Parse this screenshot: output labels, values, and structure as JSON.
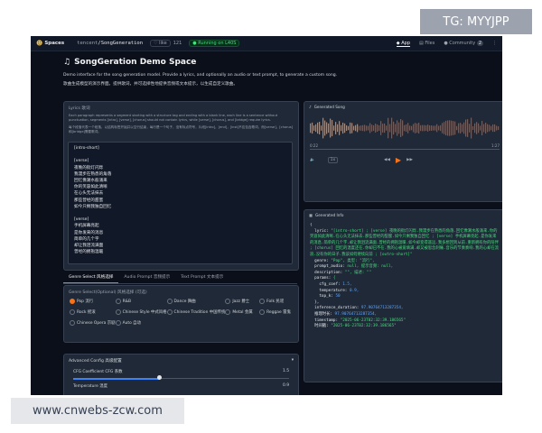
{
  "watermark_top": "TG: MYYJPP",
  "watermark_bottom": "www.cnwebs-zcw.com",
  "topbar": {
    "brand": "Spaces",
    "org": "tencent",
    "repo": "SongGeneration",
    "like_label": "like",
    "likes": "121",
    "status": "Running on L40S",
    "nav": {
      "app": "App",
      "files": "Files",
      "community": "Community",
      "community_count": "2"
    }
  },
  "header": {
    "title": "SongGeration Demo Space",
    "desc_en": "Demo interface for the song generation model. Provide a lyrics, and optionally an audio or text prompt, to generate a custom song.",
    "desc_zh": "歌曲生成模型的演示界面。提供歌词，并可选择性地提供音频或文本提示，以生成自定义歌曲。"
  },
  "lyrics": {
    "label": "Lyrics 歌词",
    "help_en": "Each paragraph represents a segment starting with a structure tag and ending with a blank line, each line is a sentence without punctuation, segments [intro], [verse], [chorus] should not contain lyrics, while [verse], [chorus], and [bridge] require lyrics.",
    "help_zh": "每个段落代表一个段落，以结构标签开始并以空行结束，每行是一个句子，没有标点符号，片段[intro]，[end]，[inst]不应包含歌词，而[verse]，[chorus]和[bridge]需要歌词。",
    "text": "[intro-short]\n\n[verse]\n夜晚的街灯闪烁\n我漫步在熟悉的角落\n回忆像潮水般涌来\n你的笑容如此清晰\n在心头无法抹去\n那些曾经的甜蜜\n如今只剩我独自回忆\n\n[verse]\n手机屏幕亮起\n是你发来的消息\n简单的几个字\n却让我泪流满面\n曾经的拥抱温暖"
  },
  "generated_song": {
    "label": "Generated Song",
    "time_current": "0:22",
    "time_total": "1:27",
    "speed": "1x"
  },
  "generated_info": {
    "label": "Generated Info",
    "lines": [
      {
        "k": "{",
        "v": ""
      },
      {
        "k": "  lyric: ",
        "v": "\"[intro-short] ; [verse] 夜晚的街灯闪烁.我漫步在熟悉的角落.回忆像潮水般涌来.你的笑容如此清晰.在心头无法抹去.那些曾经的甜蜜.如今只剩我独自回忆 ; [verse] 手机屏幕亮起.是你发来的消息.简单的几个字.却让我泪流满面.曾经的拥抱温暖.如今却变得遥远.我多想回到从前.重新拥有你的陪伴 ; [chorus] 回忆的温度还在.你却已不在.我的心被爱填满.却又被思念刺痛.音乐的节奏奏响.我的心却在流浪.没有你的日子.我该如何继续向前 ; [outro-short]\""
      },
      {
        "k": "  genre: ",
        "v": "\"Pop\", 类型: \"流行\","
      },
      {
        "k": "  prompt_audio: ",
        "v": "null, 提示音频: null,"
      },
      {
        "k": "  description: ",
        "v": "\"\", 描述: \"\""
      },
      {
        "k": "  params: ",
        "v": "{"
      },
      {
        "k": "    cfg_coef: ",
        "v": "1.5,"
      },
      {
        "k": "    temperature: ",
        "v": "0.9,"
      },
      {
        "k": "    top_k: ",
        "v": "50"
      },
      {
        "k": "  },",
        "v": ""
      },
      {
        "k": "  inference_duration: ",
        "v": "97.90764713287354,"
      },
      {
        "k": "  推理时长: ",
        "v": "97.90764713287354,"
      },
      {
        "k": "  timestamp: ",
        "v": "\"2025-06-23T02:32:39.186565\""
      },
      {
        "k": "  时间戳: ",
        "v": "\"2025-06-23T02:32:39.186565\""
      }
    ]
  },
  "tabs": [
    "Genre Select 风格选择",
    "Audio Prompt 音频提示",
    "Text Prompt 文本提示"
  ],
  "genre": {
    "label": "Genre Select(Optional) 风格选择 (可选)",
    "selected": "Pop 流行",
    "options": [
      "Pop 流行",
      "R&B",
      "Dance 舞曲",
      "Jazz 爵士",
      "Folk 民谣",
      "Rock 摇滚",
      "Chinese Style 中式风格",
      "Chinese Tradition 中国传统",
      "Metal 金属",
      "Reggae 雷鬼",
      "Chinese Opera 京剧",
      "Auto 自动"
    ]
  },
  "advanced": {
    "label": "Advanced Config 高级配置",
    "cfg_label": "CFG Coefficient CFG 系数",
    "cfg_value": "1.5",
    "cfg_fraction": 0.4,
    "temp_label": "Temperature 温度",
    "temp_value": "0.9"
  },
  "colors": {
    "accent": "#f97316",
    "background": "#0b0f19",
    "panel": "#1f2937"
  }
}
